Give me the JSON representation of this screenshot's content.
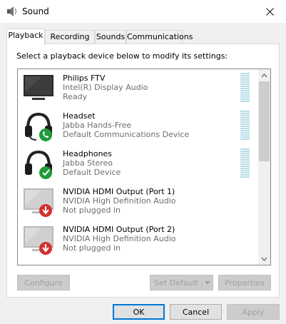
{
  "window": {
    "title": "Sound",
    "close_icon": "close-icon"
  },
  "tabs": [
    {
      "label": "Playback",
      "active": true
    },
    {
      "label": "Recording",
      "active": false
    },
    {
      "label": "Sounds",
      "active": false
    },
    {
      "label": "Communications",
      "active": false
    }
  ],
  "instruction": "Select a playback device below to modify its settings:",
  "devices": [
    {
      "name": "Philips FTV",
      "driver": "Intel(R) Display Audio",
      "status": "Ready",
      "icon": "monitor-icon",
      "badge": null
    },
    {
      "name": "Headset",
      "driver": "Jabba Hands-Free",
      "status": "Default Communications Device",
      "icon": "headset-icon",
      "badge": "phone-badge-icon"
    },
    {
      "name": "Headphones",
      "driver": "Jabba Stereo",
      "status": "Default Device",
      "icon": "headphones-icon",
      "badge": "checkmark-badge-icon"
    },
    {
      "name": "NVIDIA HDMI Output (Port 1)",
      "driver": "NVIDIA High Definition Audio",
      "status": "Not plugged in",
      "icon": "monitor-icon",
      "badge": "unplugged-badge-icon"
    },
    {
      "name": "NVIDIA HDMI Output (Port 2)",
      "driver": "NVIDIA High Definition Audio",
      "status": "Not plugged in",
      "icon": "monitor-icon",
      "badge": "unplugged-badge-icon"
    }
  ],
  "buttons": {
    "configure": "Configure",
    "set_default": "Set Default",
    "properties": "Properties",
    "ok": "OK",
    "cancel": "Cancel",
    "apply": "Apply"
  },
  "colors": {
    "accent": "#0078d7",
    "badge_green": "#1e9a3a",
    "badge_red": "#d32f2f",
    "meter": "#b8dbe8"
  }
}
